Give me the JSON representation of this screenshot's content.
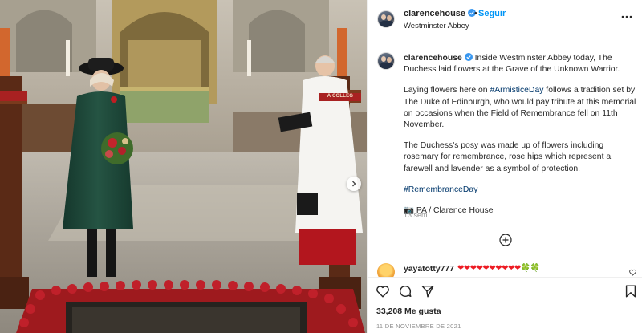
{
  "post": {
    "username": "clarencehouse",
    "follow_label": "Seguir",
    "separator": "•",
    "location": "Westminster Abbey",
    "caption": {
      "username": "clarencehouse",
      "p1": "Inside Westminster Abbey today, The Duchess laid flowers at the Grave of the Unknown Warrior.",
      "p2_before": "Laying flowers here on ",
      "p2_tag": "#ArmisticeDay",
      "p2_after": " follows a tradition set by The Duke of Edinburgh, who would pay tribute at this memorial on occasions when the Field of Remembrance fell on 11th November.",
      "p3": "The Duchess's posy was made up of flowers including rosemary for remembrance, rose hips which represent a farewell and lavender as a symbol of protection.",
      "p4_tag": "#RemembranceDay",
      "p5": "📷 PA / Clarence House"
    },
    "time_ago": "13 sem",
    "likes": "33,208 Me gusta",
    "date": "11 DE NOVIEMBRE DE 2021"
  },
  "comment": {
    "username": "yayatotty777",
    "text": "❤❤❤❤❤❤❤❤❤❤🍀🍀"
  },
  "photo": {
    "wreath_banner": "A COLLEG"
  },
  "icons": {
    "verified": "verified-badge-icon",
    "more": "more-options-icon",
    "add": "load-more-comments-icon",
    "like": "heart-icon",
    "comment": "comment-icon",
    "share": "share-icon",
    "save": "bookmark-icon",
    "next": "chevron-right-icon"
  },
  "colors": {
    "accent": "#0095f6",
    "hashtag": "#00376b",
    "muted": "#8e8e8e"
  }
}
